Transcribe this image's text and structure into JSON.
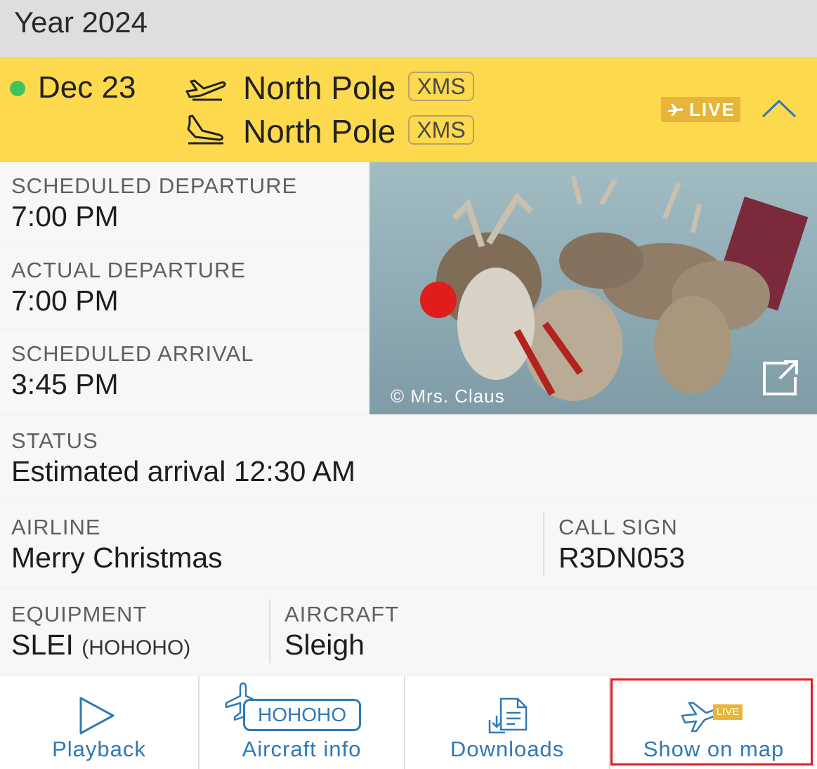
{
  "header": {
    "year_label": "Year 2024"
  },
  "flight": {
    "date": "Dec 23",
    "origin": {
      "name": "North Pole",
      "code": "XMS"
    },
    "destination": {
      "name": "North Pole",
      "code": "XMS"
    },
    "live_label": "LIVE",
    "status_color": "#3ec45c",
    "bar_color": "#fdd94e"
  },
  "times": {
    "scheduled_departure": {
      "label": "SCHEDULED DEPARTURE",
      "value": "7:00 PM"
    },
    "actual_departure": {
      "label": "ACTUAL DEPARTURE",
      "value": "7:00 PM"
    },
    "scheduled_arrival": {
      "label": "SCHEDULED ARRIVAL",
      "value": "3:45 PM"
    }
  },
  "photo": {
    "credit": "© Mrs. Claus"
  },
  "status": {
    "label": "STATUS",
    "value": "Estimated arrival 12:30 AM"
  },
  "airline": {
    "label": "AIRLINE",
    "value": "Merry Christmas"
  },
  "call_sign": {
    "label": "CALL SIGN",
    "value": "R3DN053"
  },
  "equipment": {
    "label": "EQUIPMENT",
    "code": "SLEI",
    "sub": "(HOHOHO)"
  },
  "aircraft": {
    "label": "AIRCRAFT",
    "value": "Sleigh"
  },
  "tabs": {
    "playback": {
      "label": "Playback",
      "icon": "play-icon"
    },
    "aircraft_info": {
      "label": "Aircraft info",
      "badge": "HOHOHO",
      "icon": "aircraft-registration-icon"
    },
    "downloads": {
      "label": "Downloads",
      "icon": "downloads-icon"
    },
    "show_on_map": {
      "label": "Show on map",
      "badge": "LIVE",
      "icon": "live-plane-icon"
    },
    "accent_color": "#2f79b7",
    "highlight_color": "#e21d24"
  }
}
